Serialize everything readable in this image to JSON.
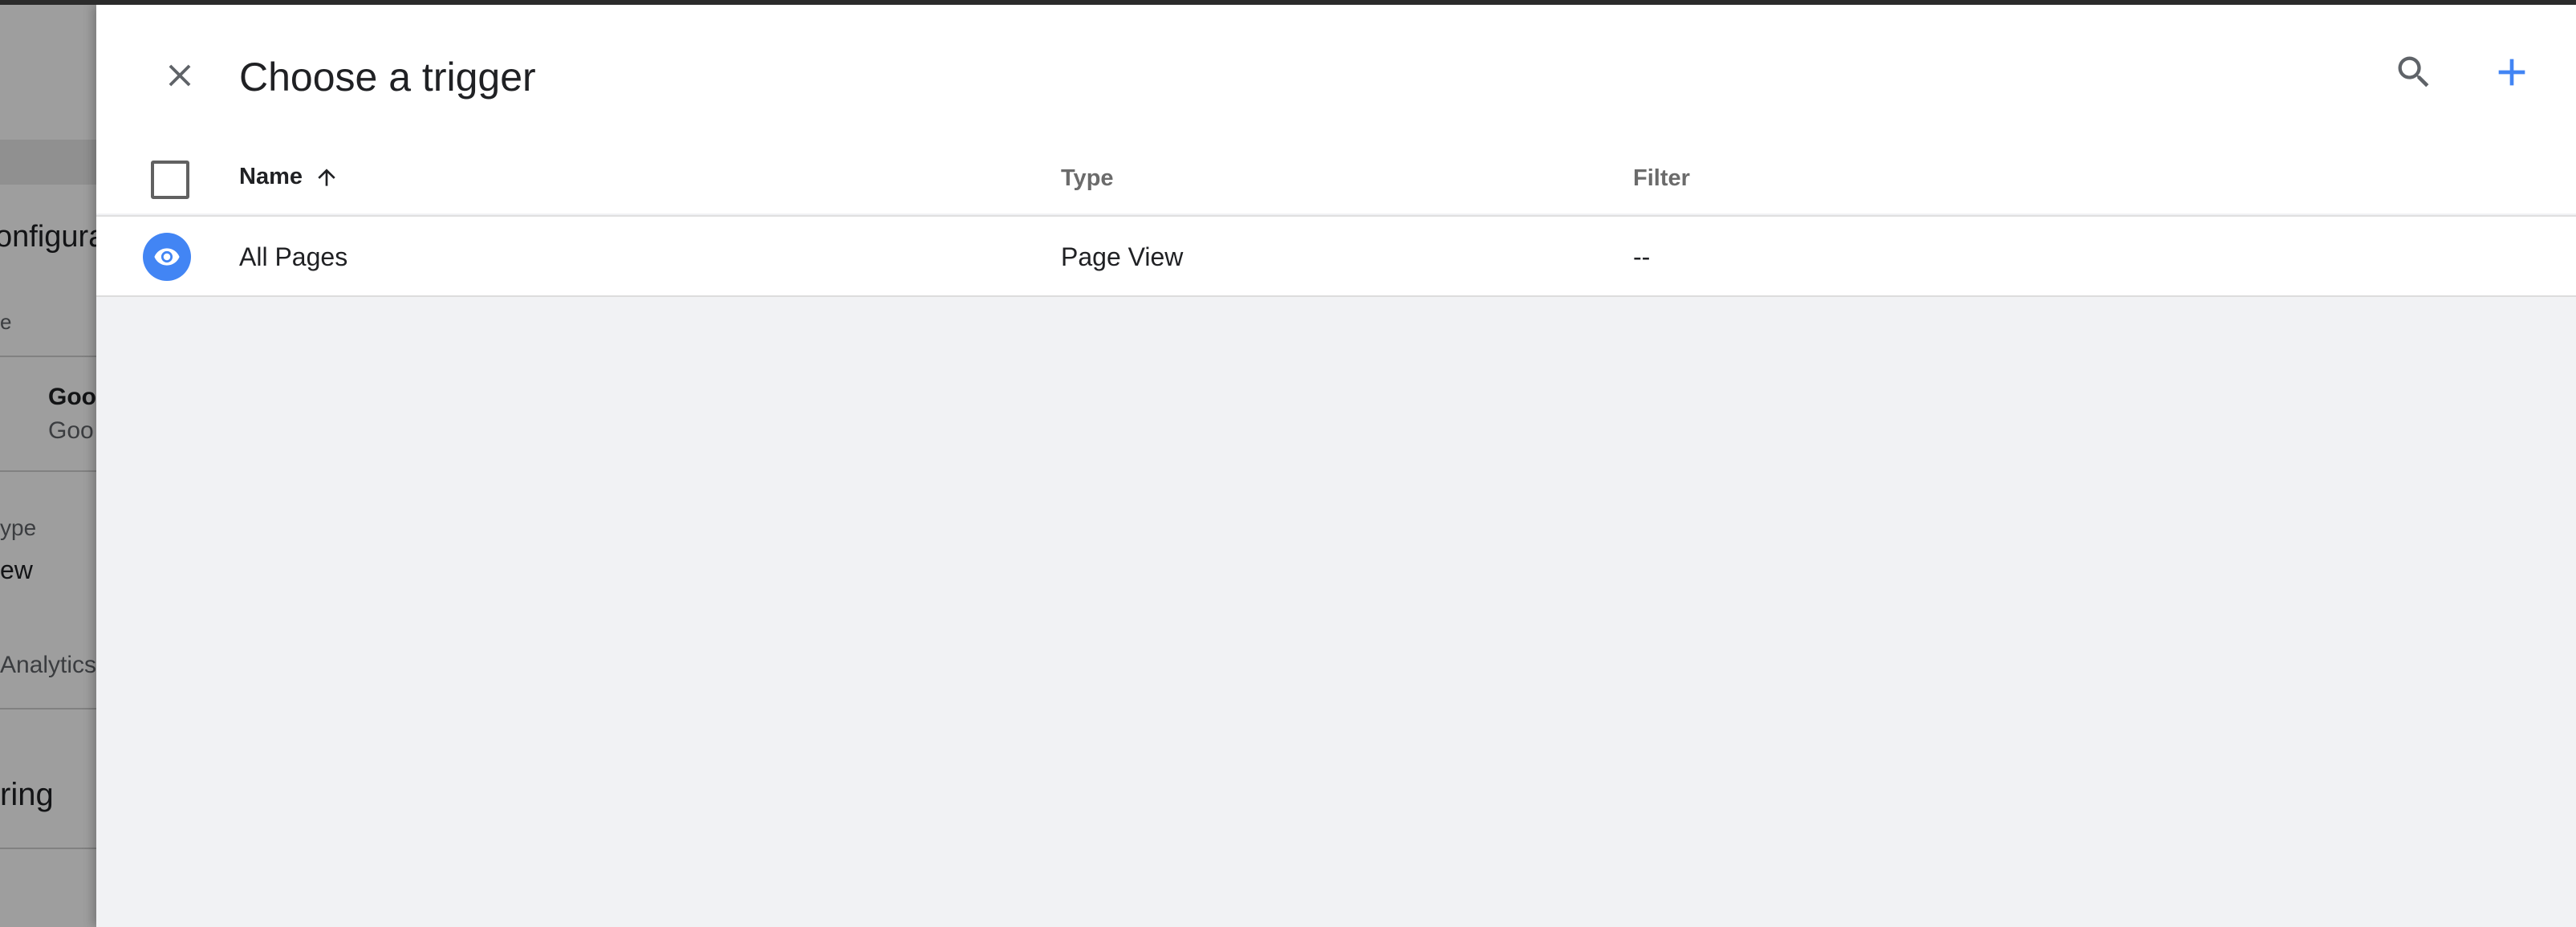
{
  "background_page": {
    "partial_labels": [
      "onfigura",
      "e",
      "Goo",
      "Goo",
      "ype",
      "ew",
      "Analytics",
      "ring"
    ]
  },
  "panel": {
    "title": "Choose a trigger",
    "close_icon": "close-icon",
    "search_icon": "search-icon",
    "add_icon": "add-icon",
    "accent_color": "#4285f4"
  },
  "table": {
    "columns": {
      "name": "Name",
      "type": "Type",
      "filter": "Filter"
    },
    "sort": "ascending",
    "rows": [
      {
        "icon": "eye-icon",
        "name": "All Pages",
        "type": "Page View",
        "filter": "--"
      }
    ]
  }
}
